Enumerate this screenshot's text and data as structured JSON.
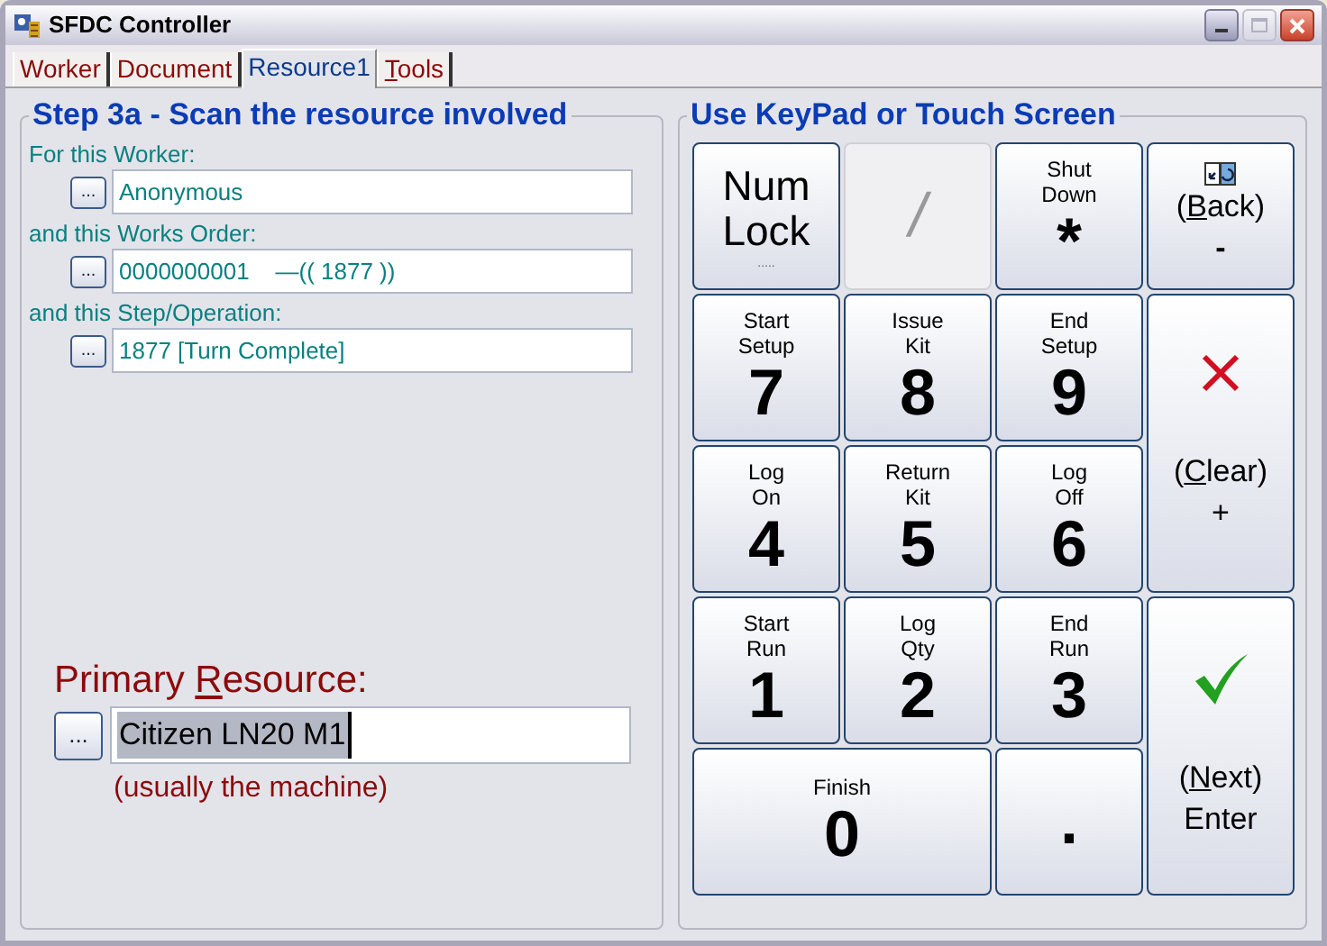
{
  "window": {
    "title": "SFDC Controller"
  },
  "tabs": [
    {
      "label": "Worker",
      "selected": false
    },
    {
      "label": "Document",
      "selected": false
    },
    {
      "label": "Resource1",
      "selected": true
    },
    {
      "label": [
        {
          "text": "T",
          "underline": true
        },
        {
          "text": "ools"
        }
      ],
      "selected": false
    }
  ],
  "scan_panel": {
    "title": "Step 3a - Scan the resource involved",
    "fields": [
      {
        "label": "For this Worker:",
        "button": "...",
        "value": "Anonymous"
      },
      {
        "label": "and this Works Order:",
        "button": "...",
        "value": "0000000001    —(( 1877 ))"
      },
      {
        "label": "and this Step/Operation:",
        "button": "...",
        "value": "1877 [Turn Complete]"
      }
    ],
    "primary": {
      "label": [
        {
          "text": "Primary "
        },
        {
          "text": "R",
          "underline": true
        },
        {
          "text": "esource:"
        }
      ],
      "button": "...",
      "value": "Citizen LN20 M1",
      "value_selected": true,
      "hint": "(usually the machine)"
    }
  },
  "keypad": {
    "title": "Use KeyPad or Touch Screen",
    "keys": [
      {
        "kind": "text",
        "lines": [
          "Num",
          "Lock"
        ],
        "sub": ".....",
        "disabled": false,
        "wide": false
      },
      {
        "kind": "symbol",
        "main": "/",
        "disabled": true,
        "wide": false
      },
      {
        "kind": "symbol",
        "caption": [
          "Shut",
          "Down"
        ],
        "main": "*",
        "disabled": false,
        "wide": false
      },
      {
        "kind": "symbol",
        "caption": [
          "Start",
          "Setup"
        ],
        "main": "7",
        "disabled": false,
        "wide": false
      },
      {
        "kind": "symbol",
        "caption": [
          "Issue",
          "Kit"
        ],
        "main": "8",
        "disabled": false,
        "wide": false
      },
      {
        "kind": "symbol",
        "caption": [
          "End",
          "Setup"
        ],
        "main": "9",
        "disabled": false,
        "wide": false
      },
      {
        "kind": "symbol",
        "caption": [
          "Log",
          "On"
        ],
        "main": "4",
        "disabled": false,
        "wide": false
      },
      {
        "kind": "symbol",
        "caption": [
          "Return",
          "Kit"
        ],
        "main": "5",
        "disabled": false,
        "wide": false
      },
      {
        "kind": "symbol",
        "caption": [
          "Log",
          "Off"
        ],
        "main": "6",
        "disabled": false,
        "wide": false
      },
      {
        "kind": "symbol",
        "caption": [
          "Start",
          "Run"
        ],
        "main": "1",
        "disabled": false,
        "wide": false
      },
      {
        "kind": "symbol",
        "caption": [
          "Log",
          "Qty"
        ],
        "main": "2",
        "disabled": false,
        "wide": false
      },
      {
        "kind": "symbol",
        "caption": [
          "End",
          "Run"
        ],
        "main": "3",
        "disabled": false,
        "wide": false
      },
      {
        "kind": "symbol",
        "caption": [
          "Finish"
        ],
        "main": "0",
        "disabled": false,
        "wide": true
      },
      {
        "kind": "symbol",
        "main": ".",
        "disabled": false,
        "wide": false
      }
    ],
    "action_keys": [
      {
        "kind": "back",
        "label": [
          {
            "text": "("
          },
          {
            "text": "B",
            "underline": true
          },
          {
            "text": "ack)"
          }
        ],
        "sub": "-"
      },
      {
        "kind": "clear",
        "label": [
          {
            "text": "("
          },
          {
            "text": "C",
            "underline": true
          },
          {
            "text": "lear)"
          }
        ],
        "sub": "+"
      },
      {
        "kind": "enter",
        "label": [
          {
            "text": "("
          },
          {
            "text": "N",
            "underline": true
          },
          {
            "text": "ext)"
          }
        ],
        "sub": "Enter"
      }
    ]
  }
}
